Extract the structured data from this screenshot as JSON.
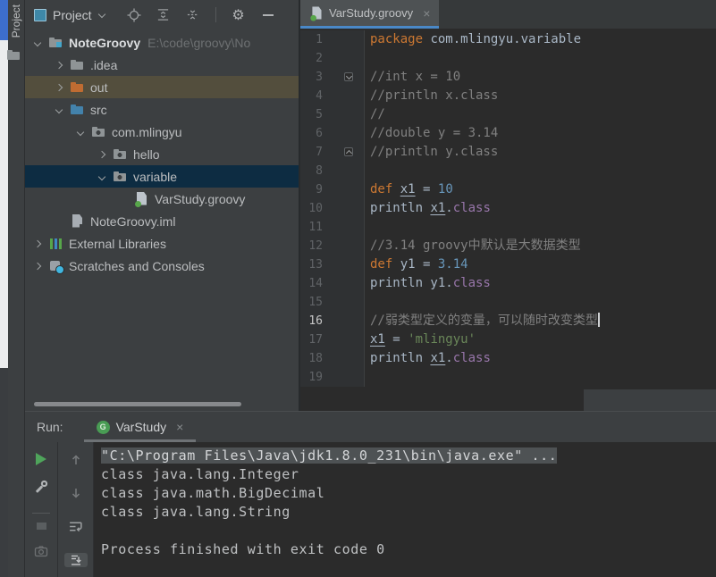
{
  "colors": {
    "keyword": "#cc7832",
    "number": "#6897bb",
    "string": "#6a8759",
    "comment": "#808080",
    "plain": "#a9b7c6",
    "property": "#9876aa",
    "tab_underline": "#4a88c7",
    "tree_selection": "#0d2c42",
    "tree_hover": "#534e3d",
    "run_icon_green": "#499c54",
    "console_selection": "#4e5254"
  },
  "toolwindow_bar": {
    "label": "Project"
  },
  "project_panel": {
    "toolbar": {
      "title": "Project"
    },
    "tree": [
      {
        "label": "NoteGroovy",
        "extra": "E:\\code\\groovy\\No",
        "level": 0,
        "chevron": "expanded",
        "icon": "project-folder",
        "bold": true,
        "highlight": null
      },
      {
        "label": ".idea",
        "level": 1,
        "chevron": "collapsed",
        "icon": "folder",
        "highlight": null
      },
      {
        "label": "out",
        "level": 1,
        "chevron": "collapsed",
        "icon": "folder-orange",
        "highlight": "hover"
      },
      {
        "label": "src",
        "level": 1,
        "chevron": "expanded",
        "icon": "folder-blue",
        "highlight": null
      },
      {
        "label": "com.mlingyu",
        "level": 2,
        "chevron": "expanded",
        "icon": "package",
        "highlight": null
      },
      {
        "label": "hello",
        "level": 3,
        "chevron": "collapsed",
        "icon": "package",
        "highlight": null
      },
      {
        "label": "variable",
        "level": 3,
        "chevron": "expanded",
        "icon": "package",
        "highlight": "selected"
      },
      {
        "label": "VarStudy.groovy",
        "level": 4,
        "chevron": "none",
        "icon": "groovy",
        "highlight": null
      },
      {
        "label": "NoteGroovy.iml",
        "level": 1,
        "chevron": "none",
        "icon": "iml",
        "highlight": null
      },
      {
        "label": "External Libraries",
        "level": 0,
        "chevron": "collapsed",
        "icon": "libraries",
        "highlight": null
      },
      {
        "label": "Scratches and Consoles",
        "level": 0,
        "chevron": "collapsed",
        "icon": "scratches",
        "highlight": null
      }
    ]
  },
  "editor": {
    "tab": {
      "title": "VarStudy.groovy",
      "close": "×"
    },
    "lines": [
      {
        "tokens": [
          [
            "k",
            "package"
          ],
          [
            "p",
            " com.mlingyu.variable"
          ]
        ]
      },
      {
        "tokens": []
      },
      {
        "fold": "start",
        "tokens": [
          [
            "c",
            "//int x = 10"
          ]
        ]
      },
      {
        "tokens": [
          [
            "c",
            "//println x.class"
          ]
        ]
      },
      {
        "tokens": [
          [
            "c",
            "//"
          ]
        ]
      },
      {
        "tokens": [
          [
            "c",
            "//double y = 3.14"
          ]
        ]
      },
      {
        "fold": "end",
        "tokens": [
          [
            "c",
            "//println y.class"
          ]
        ]
      },
      {
        "tokens": []
      },
      {
        "tokens": [
          [
            "k",
            "def"
          ],
          [
            "p",
            " "
          ],
          [
            "u",
            "x1"
          ],
          [
            "p",
            " = "
          ],
          [
            "n",
            "10"
          ]
        ]
      },
      {
        "tokens": [
          [
            "p",
            "println "
          ],
          [
            "u",
            "x1"
          ],
          [
            "p",
            "."
          ],
          [
            "cl",
            "class"
          ]
        ]
      },
      {
        "tokens": []
      },
      {
        "tokens": [
          [
            "c",
            "//3.14 groovy中默认是大数据类型"
          ]
        ]
      },
      {
        "tokens": [
          [
            "k",
            "def"
          ],
          [
            "p",
            " y1 = "
          ],
          [
            "n",
            "3.14"
          ]
        ]
      },
      {
        "tokens": [
          [
            "p",
            "println y1."
          ],
          [
            "cl",
            "class"
          ]
        ]
      },
      {
        "tokens": []
      },
      {
        "active": true,
        "cursor": true,
        "tokens": [
          [
            "c",
            "//弱类型定义的变量，可以随时改变类型"
          ]
        ]
      },
      {
        "tokens": [
          [
            "u",
            "x1"
          ],
          [
            "p",
            " = "
          ],
          [
            "s",
            "'mlingyu'"
          ]
        ]
      },
      {
        "tokens": [
          [
            "p",
            "println "
          ],
          [
            "u",
            "x1"
          ],
          [
            "p",
            "."
          ],
          [
            "cl",
            "class"
          ]
        ]
      },
      {
        "tokens": []
      }
    ]
  },
  "run_panel": {
    "label": "Run:",
    "tab": {
      "title": "VarStudy",
      "icon_letter": "G",
      "close": "×"
    },
    "console": [
      {
        "text": "\"C:\\Program Files\\Java\\jdk1.8.0_231\\bin\\java.exe\" ...",
        "selected": true
      },
      {
        "text": "class java.lang.Integer",
        "selected": false
      },
      {
        "text": "class java.math.BigDecimal",
        "selected": false
      },
      {
        "text": "class java.lang.String",
        "selected": false
      },
      {
        "text": "",
        "selected": false
      },
      {
        "text": "Process finished with exit code 0",
        "selected": false
      }
    ]
  }
}
